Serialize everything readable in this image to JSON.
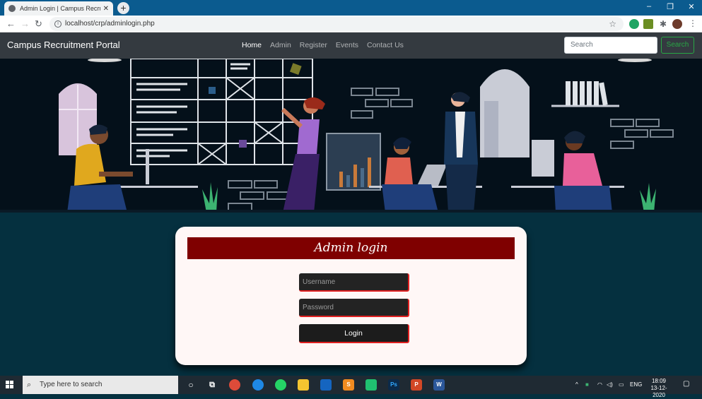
{
  "browser": {
    "tab_title": "Admin Login | Campus Recruitm",
    "tab_close": "✕",
    "new_tab": "+",
    "url": "localhost/crp/adminlogin.php",
    "window_controls": {
      "minimize": "–",
      "restore": "❐",
      "close": "✕"
    }
  },
  "navbar": {
    "brand": "Campus Recruitment Portal",
    "links": [
      "Home",
      "Admin",
      "Register",
      "Events",
      "Contact Us"
    ],
    "active_link": "Home",
    "search_placeholder": "Search",
    "search_button": "Search"
  },
  "login": {
    "title": "Admin login",
    "username_placeholder": "Username",
    "password_placeholder": "Password",
    "login_button": "Login"
  },
  "taskbar": {
    "search_placeholder": "Type here to search",
    "language": "ENG",
    "time": "18:09",
    "date": "13-12-2020",
    "apps": [
      "task-view",
      "chrome",
      "edge",
      "whatsapp",
      "file-explorer",
      "app-box",
      "sublime-text",
      "pycharm",
      "photoshop",
      "powerpoint",
      "word"
    ]
  },
  "colors": {
    "navbar_bg": "#343a40",
    "login_header": "#7f0000",
    "page_bg": "#05303f",
    "search_green": "#28a745",
    "field_accent": "#e02020"
  }
}
